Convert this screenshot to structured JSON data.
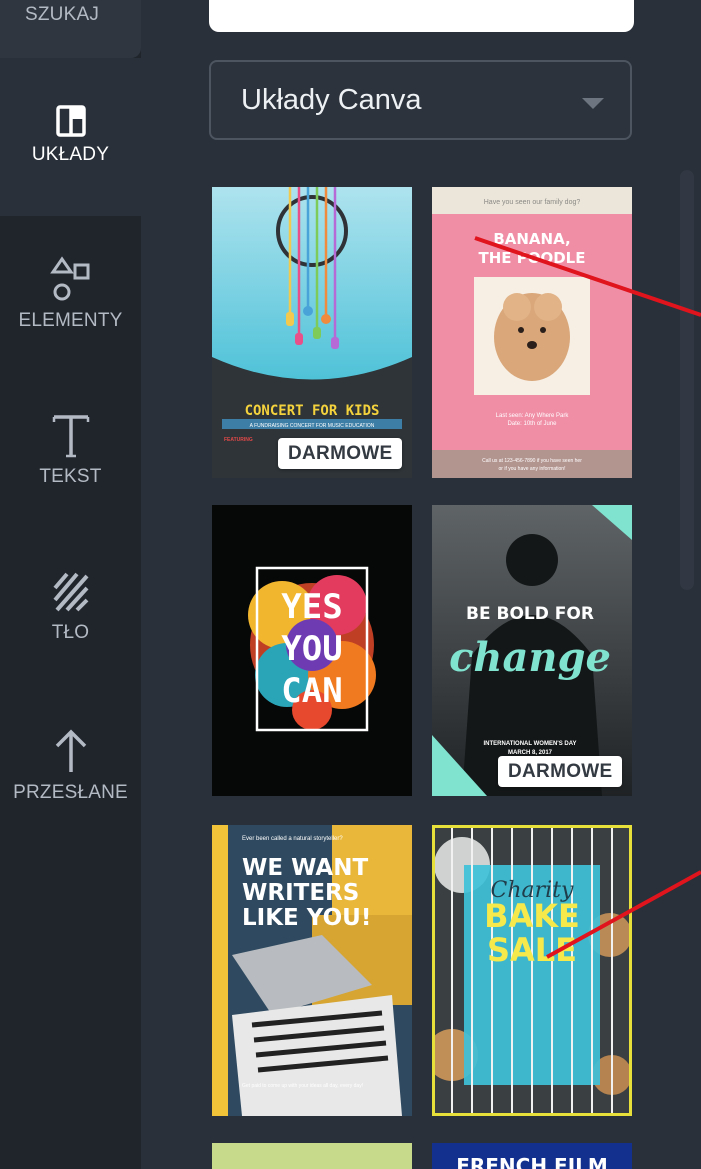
{
  "nav": {
    "search": "SZUKAJ",
    "layouts": "UKŁADY",
    "elements": "ELEMENTY",
    "text": "TEKST",
    "background": "TŁO",
    "uploads": "PRZESŁANE"
  },
  "dropdown": {
    "value": "Układy Canva"
  },
  "badges": {
    "free": "DARMOWE"
  },
  "tiles": [
    {
      "title": "CONCERT FOR KIDS",
      "subtitle": "A FUNDRAISING CONCERT FOR MUSIC EDUCATION",
      "label": "FEATURING",
      "free": true
    },
    {
      "header": "Have you seen our family dog?",
      "title_line1": "BANANA,",
      "title_line2": "THE POODLE",
      "body": "Last seen: Any Where Park\nDate: 10th of June",
      "footer": "Call us at 123-456-7890 if you have seen her\nor if you have any information!",
      "free": false
    },
    {
      "line1": "YES",
      "line2": "YOU",
      "line3": "CAN",
      "free": false
    },
    {
      "line1": "BE BOLD FOR",
      "line2": "change",
      "footer1": "INTERNATIONAL WOMEN'S DAY",
      "footer2": "MARCH 8, 2017",
      "free": true
    },
    {
      "header": "Ever been called a natural storyteller?",
      "line1": "WE WANT",
      "line2": "WRITERS",
      "line3": "LIKE YOU!",
      "footer": "Get paid to come up with your ideas all day, every day!",
      "free": false
    },
    {
      "line1": "Charity",
      "line2": "BAKE",
      "line3": "SALE",
      "free": false
    },
    {
      "free": false
    },
    {
      "title": "FRENCH FILM",
      "free": false
    }
  ],
  "colors": {
    "nav_bg": "#20252c",
    "panel_bg": "#293039",
    "annotation": "#e0141c"
  }
}
